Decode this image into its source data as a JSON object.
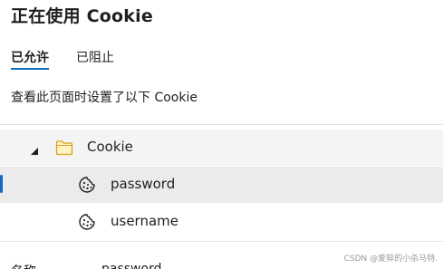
{
  "title": "正在使用 Cookie",
  "tabs": [
    {
      "label": "已允许",
      "active": true
    },
    {
      "label": "已阻止",
      "active": false
    }
  ],
  "description": "查看此页面时设置了以下 Cookie",
  "tree": {
    "folder": {
      "label": "Cookie",
      "expanded": true,
      "icon": "folder-icon"
    },
    "items": [
      {
        "label": "password",
        "icon": "cookie-icon",
        "selected": true
      },
      {
        "label": "username",
        "icon": "cookie-icon",
        "selected": false
      }
    ]
  },
  "details": {
    "name_label": "名称",
    "name_value": "password"
  },
  "watermark": "CSDN @爱猝的小杀马特.",
  "colors": {
    "accent": "#0f6cbd",
    "folder_fill": "#fff3c4",
    "folder_stroke": "#d6a21e",
    "selected_bg": "#ebebeb"
  }
}
